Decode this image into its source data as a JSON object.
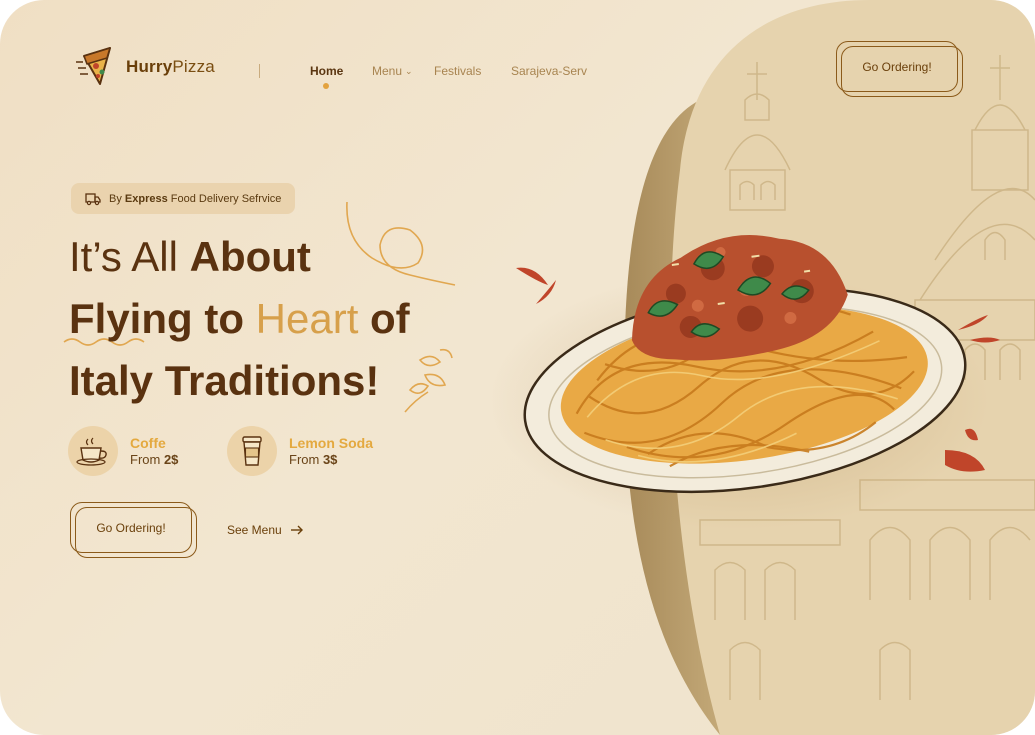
{
  "brand": {
    "name_bold": "Hurry",
    "name_regular": "Pizza"
  },
  "nav": {
    "items": [
      {
        "label": "Home",
        "active": true
      },
      {
        "label": "Menu",
        "has_dropdown": true
      },
      {
        "label": "Festivals"
      },
      {
        "label": "Sarajeva-Serv"
      }
    ]
  },
  "header": {
    "cta_label": "Go Ordering!"
  },
  "badge": {
    "prefix": "By ",
    "bold": "Express",
    "suffix": " Food Delivery Sefrvice"
  },
  "hero": {
    "line1_regular": "It’s All ",
    "line1_bold": "About",
    "line2_bold_a": "Flying to ",
    "line2_accent": "Heart",
    "line2_bold_b": " of",
    "line3_bold": "Italy Traditions!"
  },
  "products": [
    {
      "name": "Coffe",
      "price_prefix": "From ",
      "price": "2$",
      "icon": "coffee-cup-icon"
    },
    {
      "name": "Lemon Soda",
      "price_prefix": "From ",
      "price": "3$",
      "icon": "soda-cup-icon"
    }
  ],
  "actions": {
    "primary_label": "Go Ordering!",
    "secondary_label": "See Menu",
    "secondary_icon": "arrow-right-icon"
  },
  "colors": {
    "accent": "#E4A93F",
    "brand_brown": "#5A3210",
    "background": "#F2E6D0",
    "sauce": "#C0452A"
  }
}
